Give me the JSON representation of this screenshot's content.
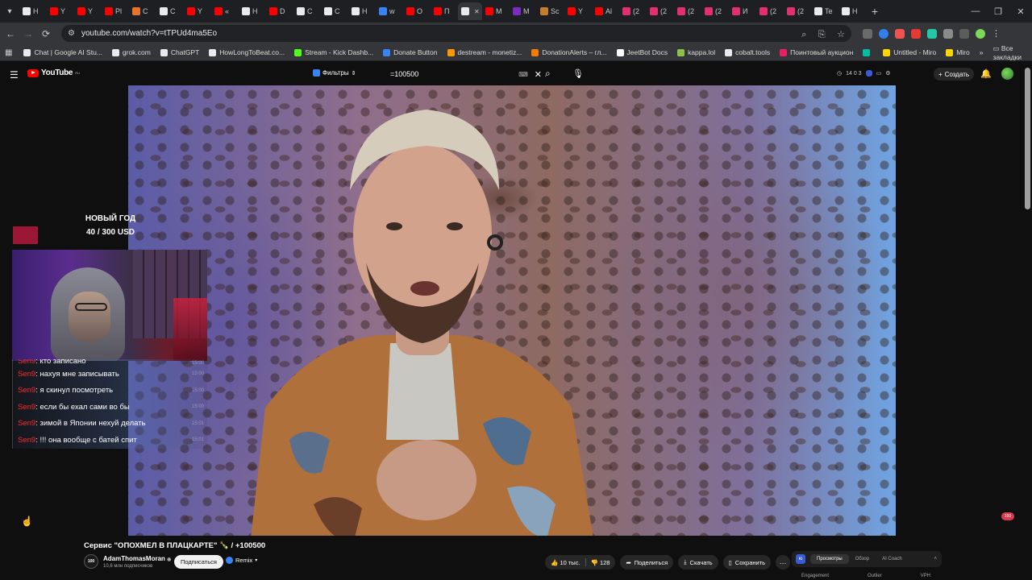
{
  "browser": {
    "tabs": [
      {
        "label": "H",
        "color": "#e8eaed"
      },
      {
        "label": "Y",
        "color": "#ff0000"
      },
      {
        "label": "Y",
        "color": "#ff0000"
      },
      {
        "label": "Pl",
        "color": "#ff0000"
      },
      {
        "label": "C",
        "color": "#e8742b"
      },
      {
        "label": "C",
        "color": "#e8eaed"
      },
      {
        "label": "Y",
        "color": "#ff0000"
      },
      {
        "label": "«",
        "color": "#ff0000"
      },
      {
        "label": "H",
        "color": "#e8eaed"
      },
      {
        "label": "D",
        "color": "#ff0000"
      },
      {
        "label": "C",
        "color": "#e8eaed"
      },
      {
        "label": "C",
        "color": "#e8eaed"
      },
      {
        "label": "H",
        "color": "#e8eaed"
      },
      {
        "label": "w",
        "color": "#3b82f6"
      },
      {
        "label": "O",
        "color": "#ff0000"
      },
      {
        "label": "П",
        "color": "#ff0000"
      },
      {
        "label": "",
        "color": "#e8eaed"
      },
      {
        "label": "M",
        "color": "#ff0000"
      },
      {
        "label": "M",
        "color": "#7b2cbf"
      },
      {
        "label": "Sc",
        "color": "#c77d2b"
      },
      {
        "label": "Y",
        "color": "#ff0000"
      },
      {
        "label": "Al",
        "color": "#ff0000"
      },
      {
        "label": "(2",
        "color": "#e1306c"
      },
      {
        "label": "(2",
        "color": "#e1306c"
      },
      {
        "label": "(2",
        "color": "#e1306c"
      },
      {
        "label": "(2",
        "color": "#e1306c"
      },
      {
        "label": "И",
        "color": "#e1306c"
      },
      {
        "label": "(2",
        "color": "#e1306c"
      },
      {
        "label": "(2",
        "color": "#e1306c"
      },
      {
        "label": "Te",
        "color": "#e8eaed"
      },
      {
        "label": "H",
        "color": "#e8eaed"
      }
    ],
    "active_tab_index": 16,
    "new_tab": "+",
    "window_controls": {
      "minimize": "—",
      "maximize": "❐",
      "close": "✕"
    },
    "nav": {
      "back": "←",
      "forward": "→",
      "reload": "⟳"
    },
    "url": "youtube.com/watch?v=tTPUd4ma5Eo",
    "bookmarks": [
      {
        "label": "Chat | Google AI Stu...",
        "color": "#e8eaed"
      },
      {
        "label": "grok.com",
        "color": "#e8eaed"
      },
      {
        "label": "ChatGPT",
        "color": "#e8eaed"
      },
      {
        "label": "HowLongToBeat.co...",
        "color": "#e8eaed"
      },
      {
        "label": "Stream - Kick Dashb...",
        "color": "#53fc18"
      },
      {
        "label": "Donate Button",
        "color": "#3b82f6"
      },
      {
        "label": "destream - monetiz...",
        "color": "#ff9800"
      },
      {
        "label": "DonationAlerts – гл...",
        "color": "#f57c00"
      },
      {
        "label": "JeetBot Docs",
        "color": "#ffffff"
      },
      {
        "label": "kappa.lol",
        "color": "#8bc34a"
      },
      {
        "label": "cobalt.tools",
        "color": "#e8eaed"
      },
      {
        "label": "Поинтовый аукцион",
        "color": "#e91e63"
      },
      {
        "label": "",
        "color": "#00bfa5"
      },
      {
        "label": "Untitled - Miro",
        "color": "#ffd600"
      },
      {
        "label": "Miro",
        "color": "#ffd600"
      }
    ],
    "bookmarks_more": "»",
    "all_bookmarks": "Все закладки"
  },
  "youtube": {
    "logo": "YouTube",
    "logo_sup": "RU",
    "filters": "Фильтры",
    "search_value": "=100500",
    "search_icon": "search-icon",
    "stats": "14  0  3",
    "create": "Создать",
    "video": {
      "title": "Сервис \"ОПОХМЕЛ В ПЛАЦКАРТЕ\" 🍾 / +100500",
      "channel": "AdamThomasMoran",
      "channel_avatar": "100",
      "subscribers": "10,6 млн подписчиков",
      "subscribe": "Подписаться",
      "remix": "Remix",
      "likes": "10 тыс.",
      "dislikes": "128",
      "share": "Поделиться",
      "download": "Скачать",
      "save": "Сохранить",
      "more": "…",
      "corner_badge": "100"
    },
    "side_panel": {
      "tabs": [
        "Просмотры",
        "Обзор",
        "AI Coach"
      ],
      "subtabs": [
        "Engagement",
        "Outlier",
        "VPH"
      ]
    }
  },
  "stream_overlay": {
    "goal_title": "НОВЫЙ ГОД",
    "goal_amount": "40 / 300 USD",
    "chat": [
      {
        "nick": "Sen9",
        "text": ": кто записано",
        "time": "15:00",
        "cut": true
      },
      {
        "nick": "Sen9",
        "text": ": нахуя мне записывать",
        "time": "15:00"
      },
      {
        "nick": "Sen9",
        "text": ": я скинул посмотреть",
        "time": "15:00"
      },
      {
        "nick": "Sen9",
        "text": ": если бы ехал сами во бы",
        "time": "15:00"
      },
      {
        "nick": "Sen9",
        "text": ": зимой в Японии нехуй делать",
        "time": "15:01"
      },
      {
        "nick": "Sen9",
        "text": ": !!! она вообще с батей спит",
        "time": "15:01"
      }
    ]
  }
}
